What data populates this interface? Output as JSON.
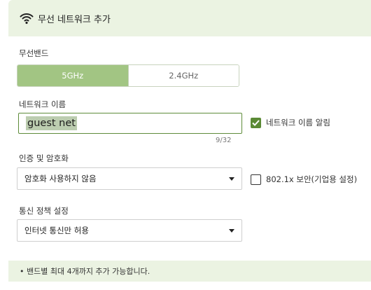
{
  "header": {
    "title": "무선 네트워크 추가",
    "icon": "wifi-icon"
  },
  "band": {
    "label": "무선밴드",
    "options": [
      "5GHz",
      "2.4GHz"
    ],
    "selected": "5GHz"
  },
  "network_name": {
    "label": "네트워크 이름",
    "value": "guest net",
    "counter": "9/32",
    "broadcast_label": "네트워크 이름 알림",
    "broadcast_checked": true
  },
  "auth": {
    "label": "인증 및 암호화",
    "selected": "암호화 사용하지 않음",
    "enterprise_label": "802.1x 보안(기업용 설정)",
    "enterprise_checked": false
  },
  "policy": {
    "label": "통신 정책 설정",
    "selected": "인터넷 통신만 허용"
  },
  "note": "• 밴드별 최대 4개까지 추가 가능합니다.",
  "colors": {
    "accent": "#a2c583",
    "header_bg": "#ebf3e2",
    "check": "#5b8a35"
  }
}
